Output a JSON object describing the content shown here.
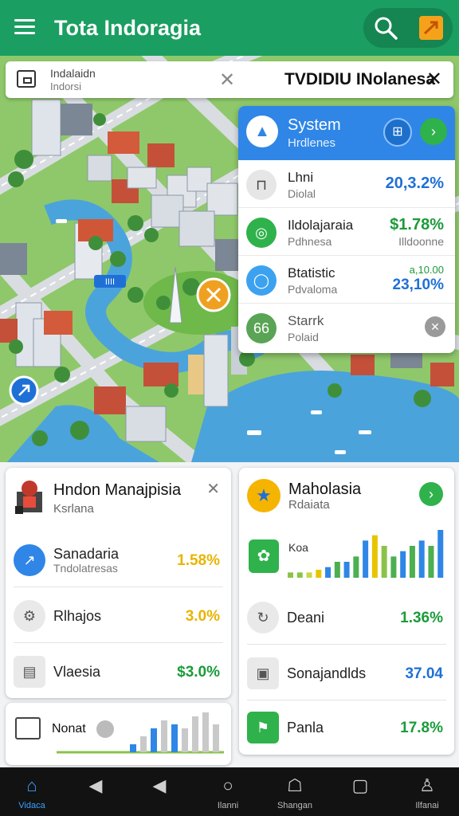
{
  "app_bar": {
    "title": "Tota Indoragia",
    "search_icon": "search-icon",
    "share_icon": "share-icon",
    "accent": "#1a9e61"
  },
  "search_bar": {
    "line1": "Indalaidn",
    "line2": "Indorsi",
    "right_text": "TVDIDIU INolanesa"
  },
  "map": {
    "flag_label": "IIII"
  },
  "system_panel": {
    "title": "System",
    "subtitle": "Hrdlenes",
    "rows": [
      {
        "name": "Lhni",
        "sub": "Diolal",
        "value": "20,3.2%",
        "value_color": "#1f70d6",
        "icon": "bag-icon",
        "icon_color": "#e0e0e0"
      },
      {
        "name": "Ildolajaraia",
        "sub": "Pdhnesa",
        "value": "$1.78%",
        "value2": "Illdoonne",
        "value_color": "#1b9b3a",
        "icon": "search-icon",
        "icon_color": "#2fb24b"
      },
      {
        "name": "Btatistic",
        "sub": "Pdvaloma",
        "value_top": "a,10.00",
        "value": "23,10%",
        "value_color": "#1f70d6",
        "icon": "chat-icon",
        "icon_color": "#3ca2f0"
      },
      {
        "name": "Starrk",
        "sub": "Polaid",
        "value": "",
        "icon": "close-icon",
        "badge": "66",
        "icon_color": "#5aa455"
      }
    ]
  },
  "card_left": {
    "title": "Hndon Manajpisia",
    "subtitle": "Ksrlana",
    "rows": [
      {
        "label": "Sanadaria",
        "sub": "Tndolatresas",
        "value": "1.58%",
        "value_color": "#e8b400",
        "icon": "trend-icon",
        "icon_bg": "#2f86e6"
      },
      {
        "label": "Rlhajos",
        "sub": "",
        "value": "3.0%",
        "value_color": "#e8b400",
        "icon": "gear-icon",
        "icon_bg": "#e9e9e9"
      },
      {
        "label": "Vlaesia",
        "sub": "",
        "value": "$3.0%",
        "value_color": "#1b9b3a",
        "icon": "document-icon",
        "icon_bg": "#e9e9e9"
      }
    ]
  },
  "card_left2": {
    "label": "Nonat",
    "bars": [
      2,
      4,
      6,
      8,
      7,
      6,
      9,
      10,
      7
    ]
  },
  "card_right": {
    "title": "Maholasia",
    "subtitle": "Rdaiata",
    "chart_label": "Koa",
    "bars": [
      {
        "value": 1,
        "color": "#8bc34a"
      },
      {
        "value": 1,
        "color": "#8bc34a"
      },
      {
        "value": 1,
        "color": "#c6d84a"
      },
      {
        "value": 1.5,
        "color": "#e8c400"
      },
      {
        "value": 2,
        "color": "#2f86e6"
      },
      {
        "value": 3,
        "color": "#4caf50"
      },
      {
        "value": 3,
        "color": "#2f86e6"
      },
      {
        "value": 4,
        "color": "#4caf50"
      },
      {
        "value": 7,
        "color": "#2f86e6"
      },
      {
        "value": 8,
        "color": "#e8c400"
      },
      {
        "value": 6,
        "color": "#8bc34a"
      },
      {
        "value": 4,
        "color": "#4caf50"
      },
      {
        "value": 5,
        "color": "#2f86e6"
      },
      {
        "value": 6,
        "color": "#4caf50"
      },
      {
        "value": 7,
        "color": "#2f86e6"
      },
      {
        "value": 6,
        "color": "#4caf50"
      },
      {
        "value": 9,
        "color": "#2f86e6"
      }
    ],
    "rows": [
      {
        "label": "Deani",
        "value": "1.36%",
        "value_color": "#1b9b3a",
        "icon": "sync-icon"
      },
      {
        "label": "Sonajandlds",
        "value": "37.04",
        "value_color": "#1f70d6",
        "icon": "bag-icon"
      },
      {
        "label": "Panla",
        "value": "17.8%",
        "value_color": "#1b9b3a",
        "icon": "flag-icon"
      }
    ]
  },
  "bottom_nav": {
    "items": [
      {
        "label": "Vidaca",
        "icon": "home-icon",
        "active": true
      },
      {
        "label": "",
        "icon": "back-icon"
      },
      {
        "label": "",
        "icon": "back-icon"
      },
      {
        "label": "Ilanni",
        "icon": "circle-icon"
      },
      {
        "label": "Shangan",
        "icon": "chat-icon"
      },
      {
        "label": "",
        "icon": "square-icon"
      },
      {
        "label": "Ilfanai",
        "icon": "person-icon"
      }
    ]
  }
}
